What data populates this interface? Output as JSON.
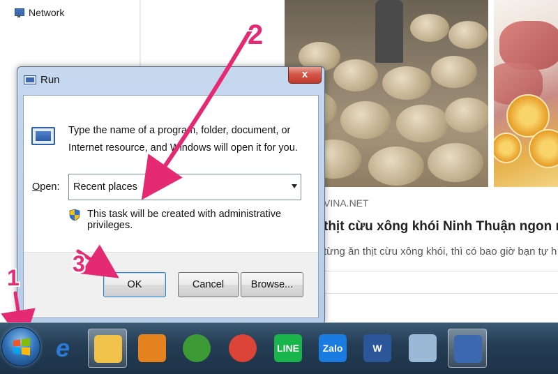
{
  "explorer": {
    "nav_item": "Network"
  },
  "article": {
    "source": "VINA.NET",
    "headline": "thịt cừu xông khói Ninh Thuận ngon nứt",
    "snippet": "từng ăn thịt cừu xông khói, thì có bao giờ bạn tự h"
  },
  "run_dialog": {
    "title": "Run",
    "close_label": "x",
    "description": "Type the name of a program, folder, document, or Internet resource, and Windows will open it for you.",
    "open_label_prefix": "O",
    "open_label_rest": "pen:",
    "open_value": "Recent places",
    "admin_note": "This task will be created with administrative privileges.",
    "ok_label": "OK",
    "cancel_label": "Cancel",
    "browse_label": "Browse..."
  },
  "annotations": {
    "step1": "1",
    "step2": "2",
    "step3": "3",
    "color": "#e52a74"
  },
  "taskbar": {
    "items": [
      {
        "icon": "internet-explorer-icon",
        "label": "e",
        "color": "#2a7ad6"
      },
      {
        "icon": "file-explorer-icon",
        "label": "",
        "color": "#f0c24a"
      },
      {
        "icon": "media-player-icon",
        "label": "",
        "color": "#e4821e"
      },
      {
        "icon": "coc-coc-browser-icon",
        "label": "",
        "color": "#3d9b35"
      },
      {
        "icon": "chrome-icon",
        "label": "",
        "color": "#db4437"
      },
      {
        "icon": "line-icon",
        "label": "LINE",
        "color": "#19b44a"
      },
      {
        "icon": "zalo-icon",
        "label": "Zalo",
        "color": "#1a7be0"
      },
      {
        "icon": "word-icon",
        "label": "W",
        "color": "#2b579a"
      },
      {
        "icon": "paint-icon",
        "label": "",
        "color": "#9bb8d6"
      },
      {
        "icon": "run-icon",
        "label": "",
        "color": "#3b68b0"
      }
    ]
  }
}
